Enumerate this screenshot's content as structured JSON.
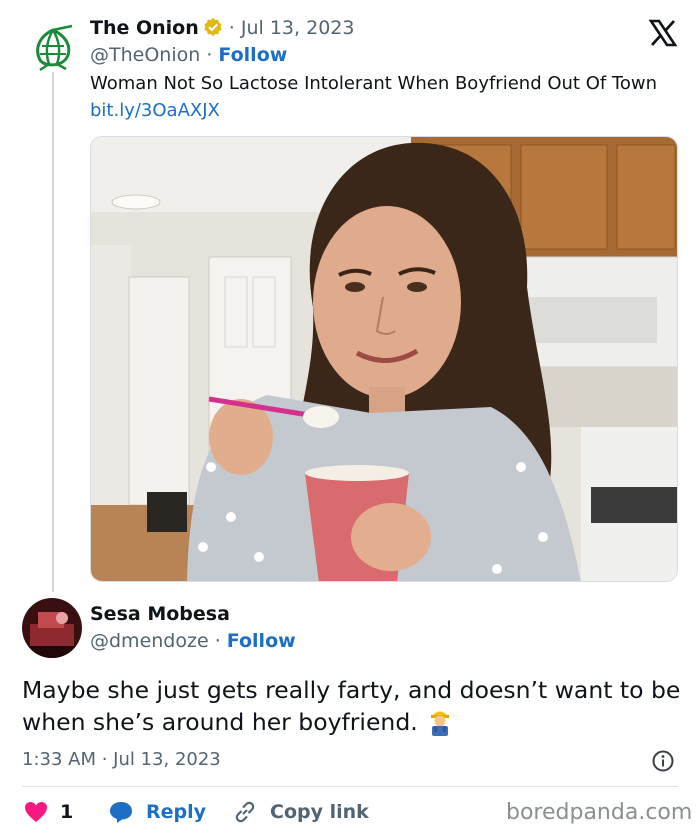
{
  "parent": {
    "name": "The Onion",
    "date": " · Jul 13, 2023",
    "handle": "@TheOnion",
    "sep": " · ",
    "follow": "Follow",
    "text": "Woman Not So Lactose Intolerant When Boyfriend Out Of Town ",
    "link": "bit.ly/3OaAXJX"
  },
  "reply": {
    "name": "Sesa Mobesa",
    "handle": "@dmendoze",
    "sep": " · ",
    "follow": "Follow",
    "text": "Maybe she just gets really farty, and doesn’t want to be when she’s around her boyfriend.",
    "time": "1:33 AM · Jul 13, 2023"
  },
  "actions": {
    "likes": "1",
    "reply": "Reply",
    "copy": "Copy link"
  },
  "watermark": "boredpanda.com",
  "icons": [
    "onion-logo-icon",
    "verified-badge-icon",
    "x-logo-icon",
    "info-icon",
    "heart-icon",
    "reply-bubble-icon",
    "link-icon",
    "worker-emoji-icon"
  ],
  "colors": {
    "accent": "#1d6fc4",
    "like": "#f91880",
    "verified": "#e2b719",
    "onion_green": "#1b8a3a"
  }
}
